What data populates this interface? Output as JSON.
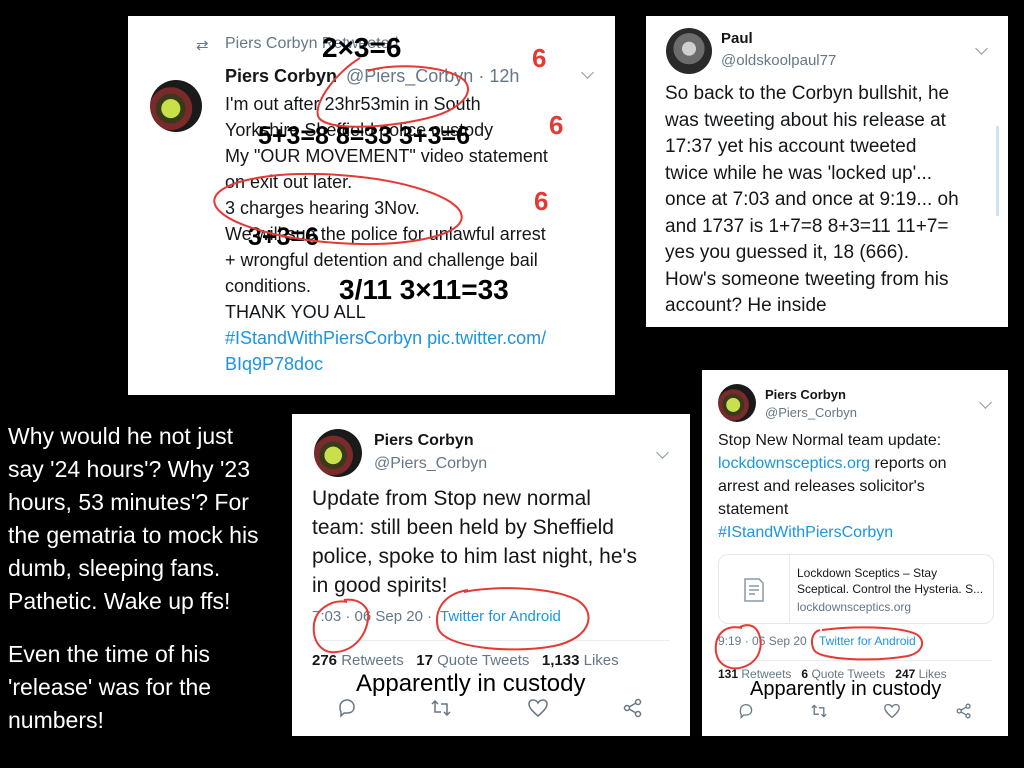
{
  "tweet1": {
    "retweet_label": "Piers Corbyn Retweeted",
    "name": "Piers Corbyn",
    "handle_time": "@Piers_Corbyn · 12h",
    "lines": [
      "I'm out after 23hr53min in South",
      "Yorkshire Sheffield police custody",
      "My \"OUR MOVEMENT\" video statement",
      "on exit out later.",
      "3 charges hearing 3Nov.",
      "We will sue the police for unlawful arrest",
      "+ wrongful detention and challenge bail",
      "conditions.",
      "THANK YOU ALL"
    ],
    "link_line1": "#IStandWithPiersCorbyn pic.twitter.com/",
    "link_line2": "BIq9P78doc",
    "annotations": {
      "a1": "2×3=6",
      "a2": "5+3=8 8=33 3+3=6",
      "a3": "3+3=6",
      "a4": "3/11 3×11=33",
      "six1": "6",
      "six2": "6",
      "six3": "6"
    }
  },
  "tweet2": {
    "name": "Paul",
    "handle": "@oldskoolpaul77",
    "lines": [
      "So back to the Corbyn bullshit, he",
      "was tweeting about his release at",
      "17:37 yet his account tweeted",
      "twice while he was 'locked up'...",
      "once at 7:03 and once at 9:19... oh",
      "and 1737 is 1+7=8 8+3=11 11+7=",
      "yes you guessed it, 18 (666).",
      "How's someone tweeting from his",
      "account? He inside"
    ]
  },
  "tweet3": {
    "name": "Piers Corbyn",
    "handle": "@Piers_Corbyn",
    "lines": [
      "Update from Stop new normal",
      "team: still been held by Sheffield",
      "police, spoke to him last night, he's",
      "in good spirits!"
    ],
    "time_date": "7:03 · 06 Sep 20 ·",
    "source": "Twitter for Android",
    "retweets_count": "276",
    "retweets_label": "Retweets",
    "quotes_count": "17",
    "quotes_label": "Quote Tweets",
    "likes_count": "1,133",
    "likes_label": "Likes",
    "annotation": "Apparently in custody"
  },
  "tweet4": {
    "name": "Piers Corbyn",
    "handle": "@Piers_Corbyn",
    "line1": "Stop New Normal team update:",
    "line2_link": "lockdownsceptics.org",
    "line2_rest": " reports on",
    "line3": "arrest and releases solicitor's",
    "line4": "statement",
    "hashtag": "#IStandWithPiersCorbyn",
    "card_title1": "Lockdown Sceptics – Stay",
    "card_title2": "Sceptical. Control the Hysteria. S...",
    "card_domain": "lockdownsceptics.org",
    "time_date": "9:19 · 06 Sep 20 ·",
    "source": "Twitter for Android",
    "retweets_count": "131",
    "retweets_label": "Retweets",
    "quotes_count": "6",
    "quotes_label": "Quote Tweets",
    "likes_count": "247",
    "likes_label": "Likes",
    "annotation": "Apparently in custody"
  },
  "side_text": {
    "lines": [
      "Why would he not just",
      "say '24 hours'? Why '23",
      "hours, 53 minutes'? For",
      "the gematria to mock his",
      "dumb, sleeping fans.",
      "Pathetic. Wake up ffs!",
      "",
      "Even the time of his",
      "'release' was for the",
      "numbers!"
    ]
  },
  "colors": {
    "link": "#1b95e0",
    "annotation_red": "#e53935",
    "background": "#000000"
  }
}
